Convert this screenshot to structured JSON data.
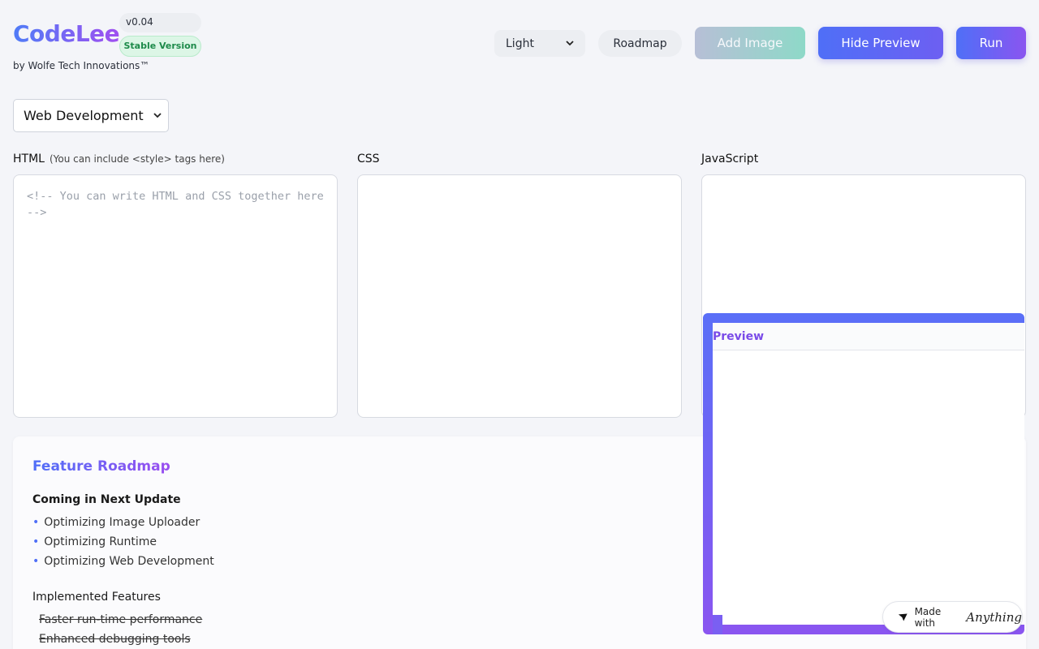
{
  "header": {
    "logo": "CodeLee",
    "byline": "by Wolfe Tech Innovations™",
    "version": "v0.04",
    "badge": "Stable Version",
    "theme_select": "Light",
    "roadmap_button": "Roadmap",
    "add_image_button": "Add Image",
    "hide_preview_button": "Hide Preview",
    "run_button": "Run"
  },
  "template_select": "Web Development",
  "editors": {
    "html": {
      "label": "HTML",
      "hint": "(You can include <style> tags here)",
      "placeholder": "<!-- You can write HTML and CSS together here -->"
    },
    "css": {
      "label": "CSS"
    },
    "js": {
      "label": "JavaScript"
    }
  },
  "roadmap": {
    "title": "Feature Roadmap",
    "next_heading": "Coming in Next Update",
    "next_items": [
      "Optimizing Image Uploader",
      "Optimizing Runtime",
      "Optimizing Web Development"
    ],
    "implemented_heading": "Implemented Features",
    "implemented_items": [
      "Faster run-time performance",
      "Enhanced debugging tools"
    ]
  },
  "preview": {
    "title": "Preview"
  },
  "made_with": {
    "prefix": "Made with",
    "brand": "Anything"
  }
}
